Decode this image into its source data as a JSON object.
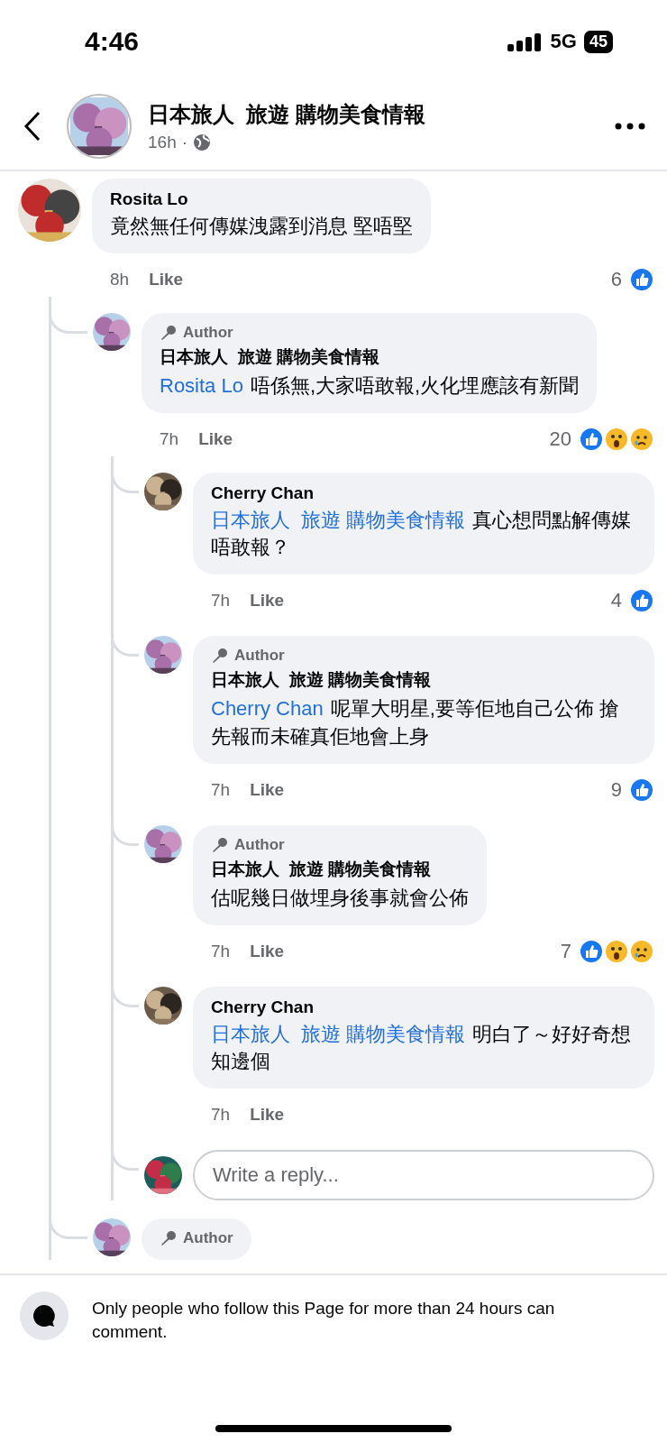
{
  "status_bar": {
    "time": "4:46",
    "network": "5G",
    "battery": "45"
  },
  "header": {
    "title": "日本旅人  旅遊 購物美食情報",
    "time": "16h",
    "separator": "·"
  },
  "comments": [
    {
      "name": "Rosita Lo",
      "text": "竟然無任何傳媒洩露到消息 堅唔堅",
      "time": "8h",
      "action": "Like",
      "count": "6",
      "reactions": [
        {
          "kind": "like"
        }
      ],
      "children": [
        {
          "badge": "Author",
          "name": "日本旅人  旅遊 購物美食情報",
          "mention": "Rosita Lo",
          "text": "唔係無,大家唔敢報,火化埋應該有新聞",
          "time": "7h",
          "action": "Like",
          "count": "20",
          "reactions": [
            {
              "kind": "like"
            },
            {
              "kind": "wow"
            },
            {
              "kind": "sad"
            }
          ],
          "children": [
            {
              "name": "Cherry Chan",
              "mention": "日本旅人  旅遊 購物美食情報",
              "text": "真心想問點解傳媒唔敢報？",
              "time": "7h",
              "action": "Like",
              "count": "4",
              "reactions": [
                {
                  "kind": "like"
                }
              ]
            },
            {
              "badge": "Author",
              "name": "日本旅人  旅遊 購物美食情報",
              "mention": "Cherry Chan",
              "text": "呢單大明星,要等佢地自己公佈 搶先報而未確真佢地會上身",
              "time": "7h",
              "action": "Like",
              "count": "9",
              "reactions": [
                {
                  "kind": "like"
                }
              ]
            },
            {
              "badge": "Author",
              "name": "日本旅人  旅遊 購物美食情報",
              "text": "估呢幾日做埋身後事就會公佈",
              "time": "7h",
              "action": "Like",
              "count": "7",
              "reactions": [
                {
                  "kind": "like"
                },
                {
                  "kind": "wow"
                },
                {
                  "kind": "sad"
                }
              ]
            },
            {
              "name": "Cherry Chan",
              "mention": "日本旅人  旅遊 購物美食情報",
              "text": "明白了～好好奇想知邊個",
              "time": "7h",
              "action": "Like"
            }
          ],
          "reply_field": {
            "placeholder": "Write a reply..."
          }
        },
        {
          "badge": "Author"
        }
      ]
    }
  ],
  "notice": {
    "text": "Only people who follow this Page for more than 24 hours can comment."
  }
}
